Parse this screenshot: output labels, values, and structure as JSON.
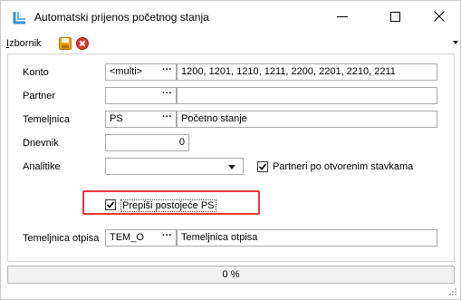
{
  "window": {
    "title": "Automatski prijenos početnog stanja",
    "icon": "app-logo-icon",
    "accent_color": "#3a8fd9"
  },
  "menu": {
    "izbornik_first": "I",
    "izbornik_rest": "zbornik",
    "save_icon": "save-icon",
    "cancel_icon": "cancel-icon"
  },
  "form": {
    "konto": {
      "label": "Konto",
      "code": "<multi>",
      "dots": "···",
      "description": "1200, 1201, 1210, 1211, 2200, 2201, 2210, 2211"
    },
    "partner": {
      "label": "Partner",
      "code": "",
      "dots": "···",
      "description": ""
    },
    "temeljnica": {
      "label": "Temeljnica",
      "code": "PS",
      "dots": "···",
      "description": "Početno stanje"
    },
    "dnevnik": {
      "label": "Dnevnik",
      "value": "0"
    },
    "analitike": {
      "label": "Analitike",
      "value": ""
    },
    "partneri_checkbox": {
      "label": "Partneri po otvorenim stavkama",
      "checked": true
    },
    "prepisi_checkbox": {
      "label": "Prepiši postojeće PS",
      "checked": true
    },
    "temeljnica_otpisa": {
      "label": "Temeljnica otpisa",
      "code": "TEM_O",
      "dots": "···",
      "description": "Temeljnica otpisa"
    }
  },
  "progress": {
    "text": "0 %",
    "value": 0
  },
  "colors": {
    "highlight": "#e8373a",
    "save_icon": "#f2a516",
    "cancel_icon": "#d83a2e"
  }
}
